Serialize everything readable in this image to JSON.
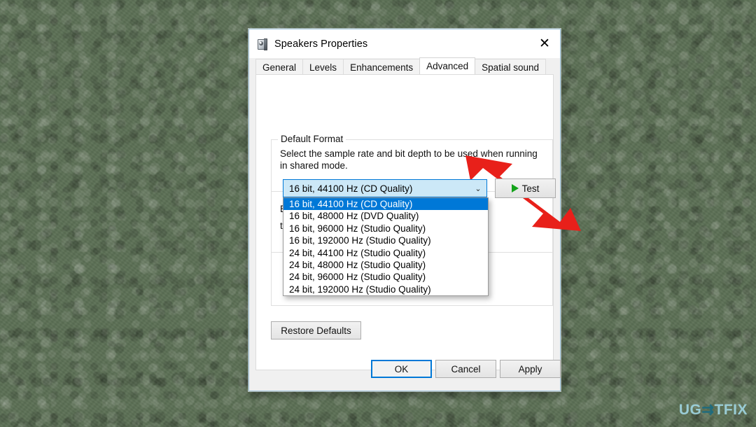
{
  "window": {
    "title": "Speakers Properties",
    "icon": "speaker-icon",
    "close_label": "✕"
  },
  "tabs": [
    {
      "label": "General",
      "selected": false
    },
    {
      "label": "Levels",
      "selected": false
    },
    {
      "label": "Enhancements",
      "selected": false
    },
    {
      "label": "Advanced",
      "selected": true
    },
    {
      "label": "Spatial sound",
      "selected": false
    }
  ],
  "default_format": {
    "legend": "Default Format",
    "description": "Select the sample rate and bit depth to be used when running in shared mode.",
    "combo_value": "16 bit, 44100 Hz (CD Quality)",
    "combo_arrow": "⌄",
    "test_button": "Test",
    "options": [
      {
        "label": "16 bit, 44100 Hz (CD Quality)",
        "selected": true
      },
      {
        "label": "16 bit, 48000 Hz (DVD Quality)",
        "selected": false
      },
      {
        "label": "16 bit, 96000 Hz (Studio Quality)",
        "selected": false
      },
      {
        "label": "16 bit, 192000 Hz (Studio Quality)",
        "selected": false
      },
      {
        "label": "24 bit, 44100 Hz (Studio Quality)",
        "selected": false
      },
      {
        "label": "24 bit, 48000 Hz (Studio Quality)",
        "selected": false
      },
      {
        "label": "24 bit, 96000 Hz (Studio Quality)",
        "selected": false
      },
      {
        "label": "24 bit, 192000 Hz (Studio Quality)",
        "selected": false
      }
    ]
  },
  "exclusive_mode": {
    "legend_visible_fragment": "E",
    "line_2_visible_fragment": "this device"
  },
  "restore_defaults_button": "Restore Defaults",
  "footer": {
    "ok": "OK",
    "cancel": "Cancel",
    "apply": "Apply"
  },
  "watermark": {
    "part1": "UG",
    "part2": "⇉",
    "part3": "TFIX"
  },
  "colors": {
    "accent": "#0078d7",
    "arrow": "#e8201a",
    "desktop": "#5c7055",
    "combo_fill": "#cce8f7",
    "play_green": "#14a31a"
  }
}
